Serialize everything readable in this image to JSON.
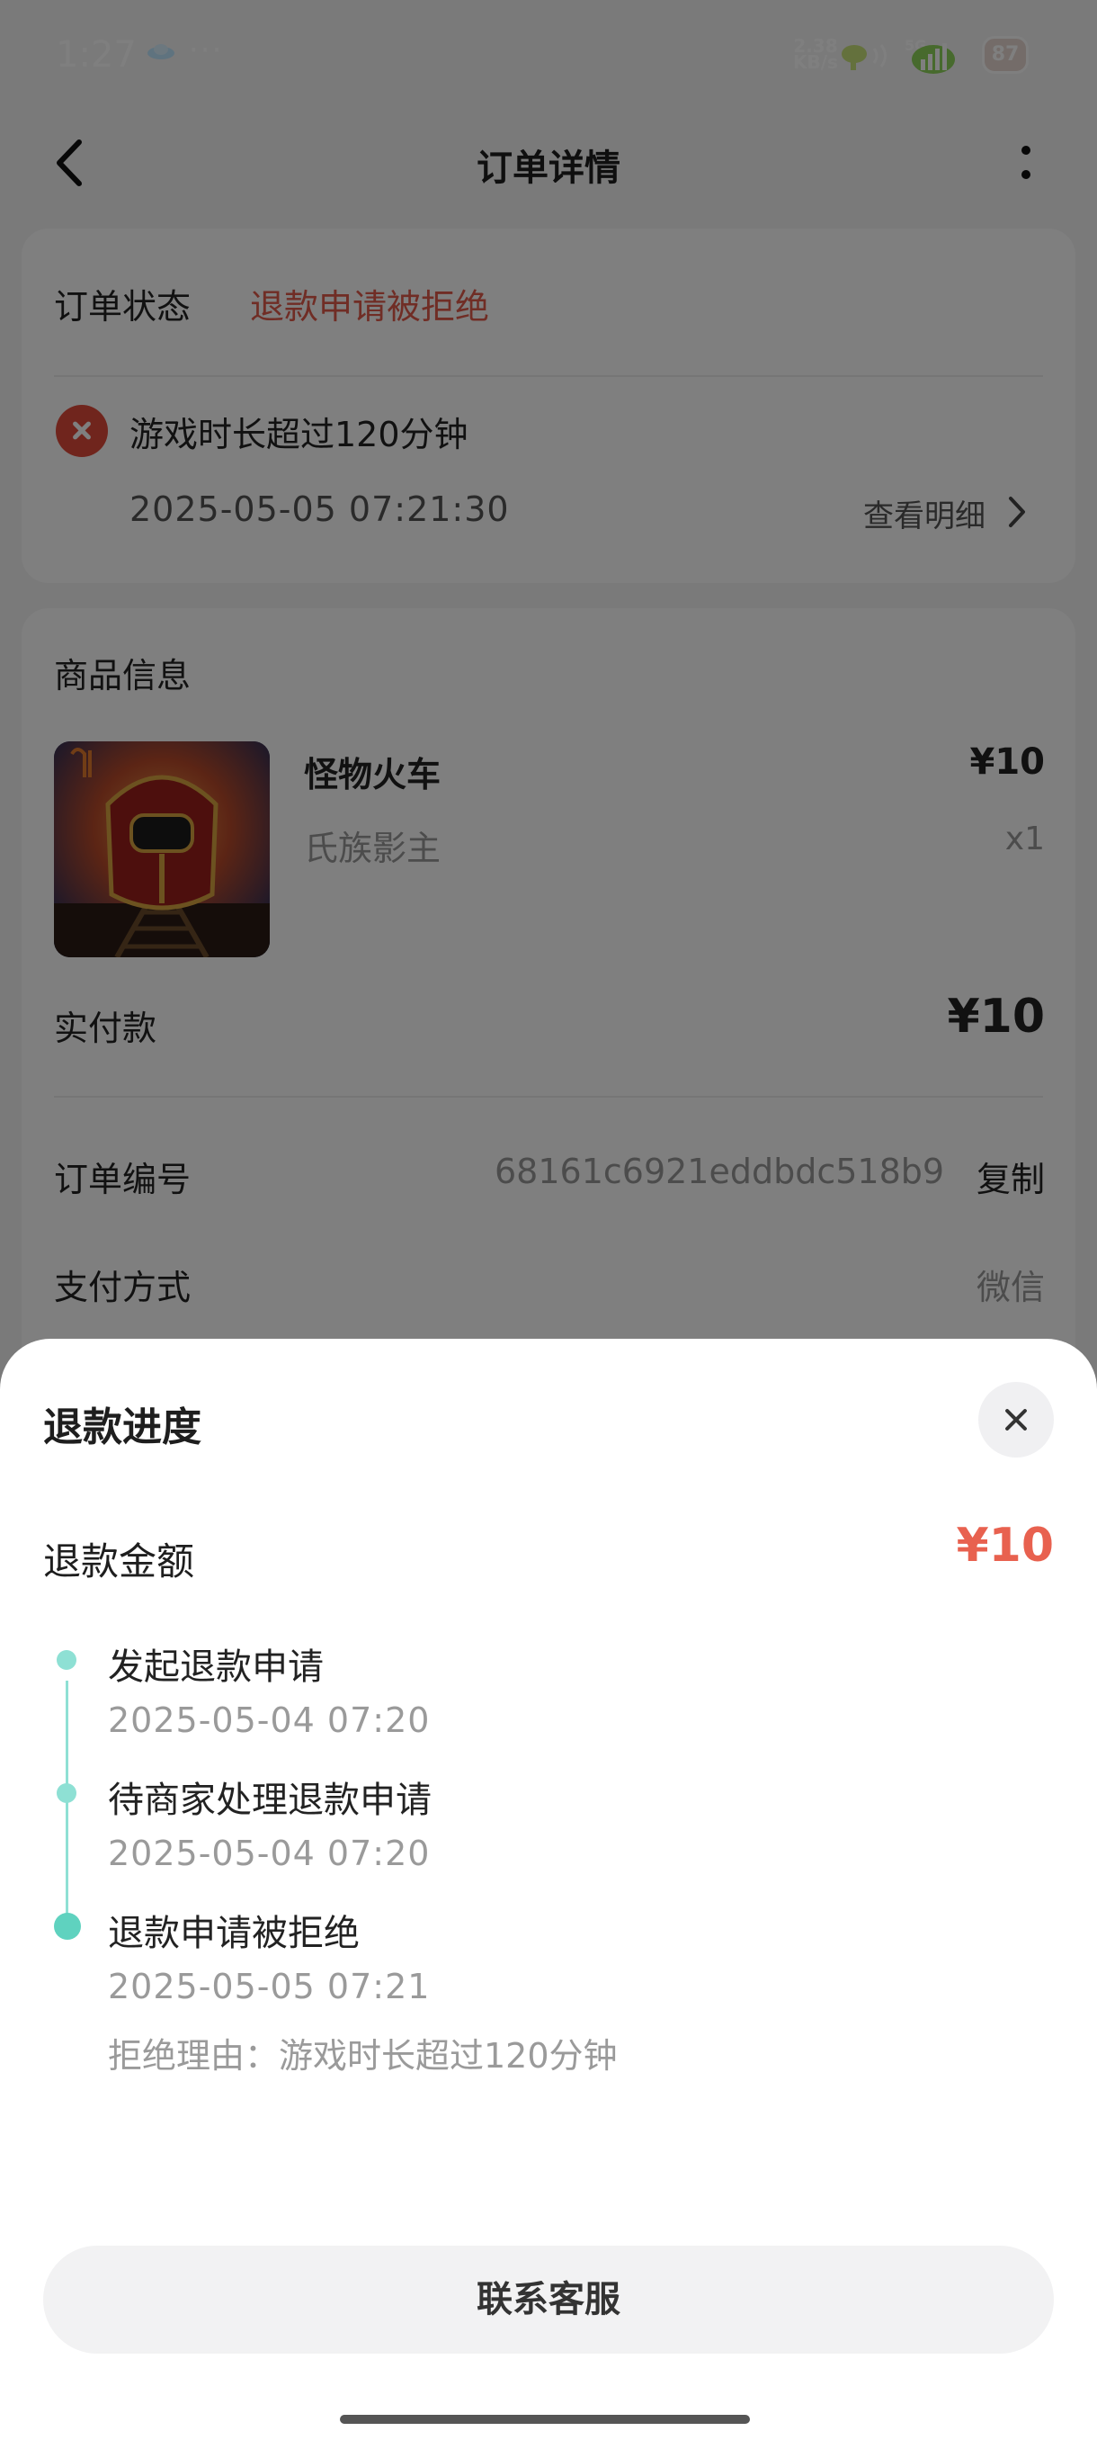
{
  "status_bar": {
    "time": "1:27",
    "dots": "···",
    "speed_value": "2.38",
    "speed_unit": "KB/s",
    "network": "5G",
    "battery": "87"
  },
  "header": {
    "title": "订单详情"
  },
  "order_status": {
    "label": "订单状态",
    "value": "退款申请被拒绝",
    "reason": "游戏时长超过120分钟",
    "time": "2025-05-05   07:21:30",
    "view_detail": "查看明细"
  },
  "goods": {
    "section_title": "商品信息",
    "name": "怪物火车",
    "seller": "氏族影主",
    "price": "¥10",
    "quantity": "x1",
    "paid_label": "实付款",
    "paid_value": "¥10",
    "order_no_label": "订单编号",
    "order_no": "68161c6921eddbdc518b9",
    "copy": "复制",
    "pay_method_label": "支付方式",
    "pay_method": "微信"
  },
  "refund_sheet": {
    "title": "退款进度",
    "amount_label": "退款金额",
    "amount_value": "¥10",
    "steps": [
      {
        "title": "发起退款申请",
        "time": "2025-05-04   07:20"
      },
      {
        "title": "待商家处理退款申请",
        "time": "2025-05-04   07:20"
      },
      {
        "title": "退款申请被拒绝",
        "time": "2025-05-05   07:21",
        "reason": "拒绝理由：游戏时长超过120分钟"
      }
    ],
    "contact_button": "联系客服"
  },
  "colors": {
    "accent_red": "#e8614f",
    "timeline_teal": "#5fd2bf"
  }
}
